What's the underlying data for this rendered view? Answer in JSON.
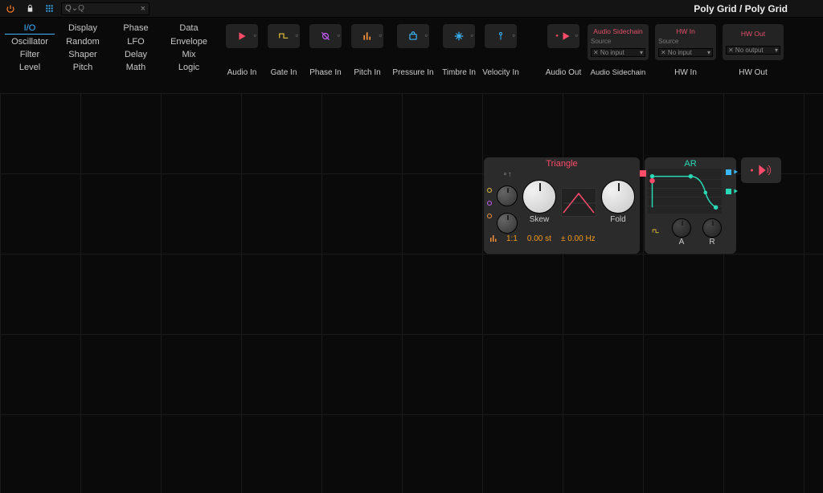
{
  "topbar": {
    "search_placeholder": "Q",
    "breadcrumb": "Poly Grid / Poly Grid"
  },
  "categories": [
    "I/O",
    "Display",
    "Phase",
    "Data",
    "Oscillator",
    "Random",
    "LFO",
    "Envelope",
    "Filter",
    "Shaper",
    "Delay",
    "Mix",
    "Level",
    "Pitch",
    "Math",
    "Logic"
  ],
  "active_category": "I/O",
  "modules": {
    "cols": [
      {
        "label": "Audio In",
        "icon": "play-red"
      },
      {
        "label": "Gate In",
        "icon": "square-yellow"
      },
      {
        "label": "Phase In",
        "icon": "phi-purple"
      },
      {
        "label": "Pitch In",
        "icon": "bars-orange"
      },
      {
        "label": "Pressure In",
        "icon": "bag-blue"
      },
      {
        "label": "Timbre In",
        "icon": "flare-blue"
      },
      {
        "label": "Velocity In",
        "icon": "key-blue"
      }
    ],
    "audio_out": {
      "label": "Audio Out",
      "icon": "play-red-out"
    },
    "hw": [
      {
        "title": "Audio Sidechain",
        "src": "Source",
        "opt": "✕ No input",
        "label": "Audio Sidechain"
      },
      {
        "title": "HW In",
        "src": "Source",
        "opt": "✕ No input",
        "label": "HW In"
      },
      {
        "title": "HW Out",
        "src": "",
        "opt": "✕ No output",
        "label": "HW Out"
      }
    ]
  },
  "triangle": {
    "title": "Triangle",
    "skew_label": "Skew",
    "fold_label": "Fold",
    "readouts": {
      "ratio": "1:1",
      "semitones": "0.00 st",
      "hertz": "± 0.00 Hz"
    }
  },
  "ar": {
    "title": "AR",
    "a_label": "A",
    "r_label": "R"
  }
}
